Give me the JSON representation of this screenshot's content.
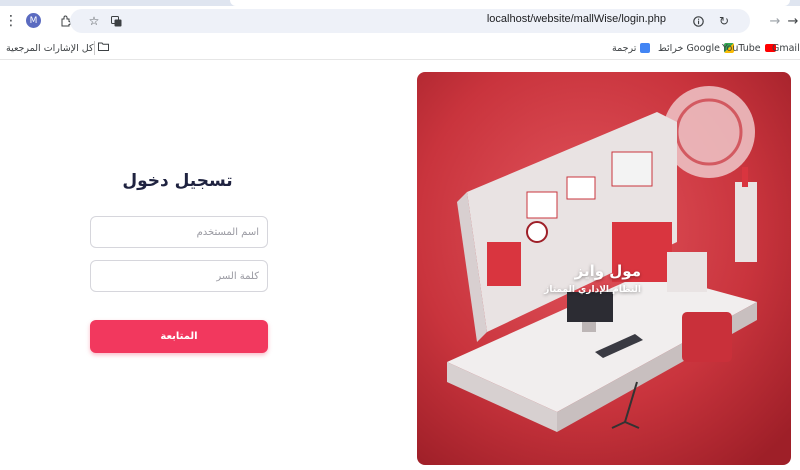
{
  "browser": {
    "url": "localhost/website/mallWise/login.php",
    "profile_initial": "M",
    "bookmarks": {
      "gmail": "Gmail",
      "youtube": "YouTube",
      "maps": "خرائط Google",
      "translate": "ترجمة",
      "all_bookmarks": "كل الإشارات المرجعية"
    }
  },
  "login": {
    "title": "تسجيل دخول",
    "username_placeholder": "اسم المستخدم",
    "password_placeholder": "كلمة السر",
    "submit_label": "المتابعة"
  },
  "hero": {
    "title": "مول وايز",
    "subtitle": "النظام الإداري الممتاز"
  },
  "colors": {
    "accent": "#f2385e",
    "title": "#1f2340",
    "hero_bg": "#c8323c"
  }
}
